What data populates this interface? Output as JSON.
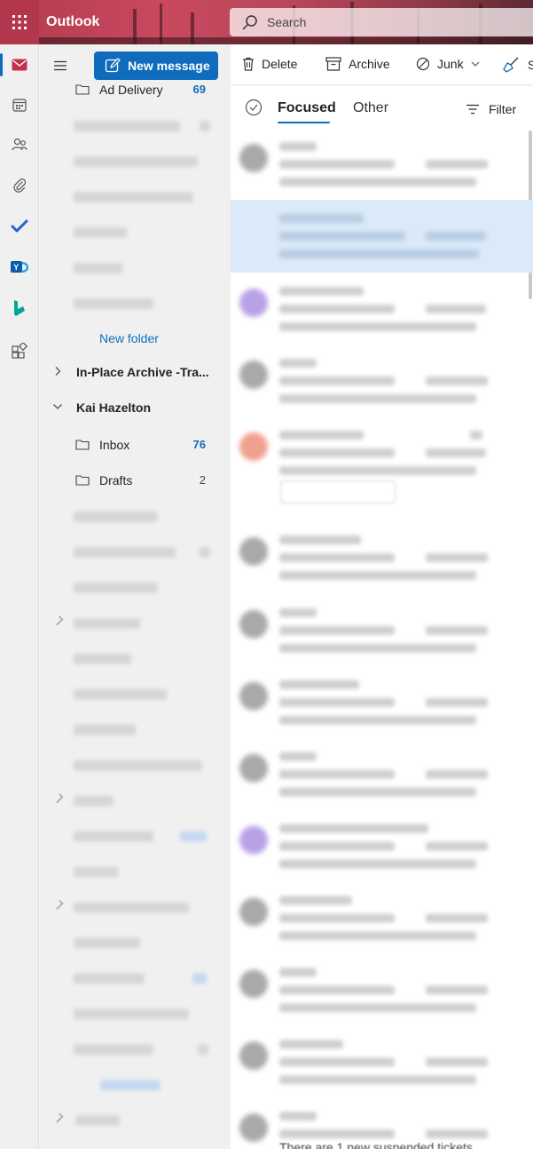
{
  "app": {
    "title": "Outlook"
  },
  "search": {
    "placeholder": "Search"
  },
  "toolbar": {
    "new_message": "New message",
    "delete": "Delete",
    "archive": "Archive",
    "junk": "Junk",
    "sweep": "S"
  },
  "folders": {
    "top_partial": {
      "label": "Ad Delivery",
      "count": "69"
    },
    "new_folder_1": "New folder",
    "archive_group": "In-Place Archive -Tra...",
    "account": "Kai Hazelton",
    "inbox": {
      "label": "Inbox",
      "count": "76"
    },
    "drafts": {
      "label": "Drafts",
      "count": "2"
    }
  },
  "tabs": {
    "focused": "Focused",
    "other": "Other",
    "filter": "Filter"
  },
  "messages": {
    "last_preview": "There are 1 new suspended tickets..."
  },
  "colors": {
    "accent": "#0f6cbd",
    "selected": "#dbe9f8",
    "avatar_purple": "#b9a1e6",
    "avatar_red": "#f1a08f",
    "avatar_gray": "#a9a9a9"
  }
}
